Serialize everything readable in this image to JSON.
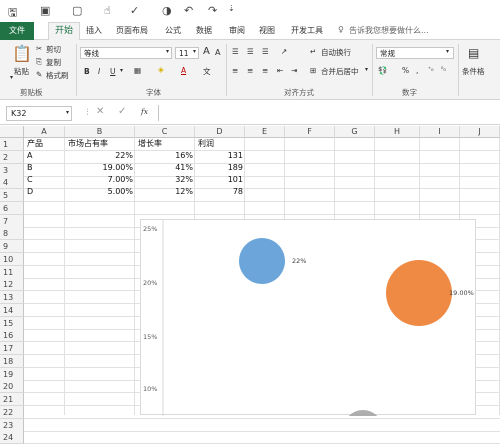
{
  "tabs": [
    "文件",
    "开始",
    "插入",
    "页面布局",
    "公式",
    "数据",
    "审阅",
    "视图",
    "开发工具"
  ],
  "tell_me": "告诉我您想要做什么...",
  "clipboard": {
    "paste": "粘贴",
    "cut": "剪切",
    "copy": "复制",
    "painter": "格式刷",
    "group": "剪贴板"
  },
  "font": {
    "name": "等线",
    "size": "11",
    "group": "字体",
    "bold": "B",
    "italic": "I",
    "underline": "U"
  },
  "align": {
    "wrap": "自动换行",
    "merge": "合并后居中",
    "group": "对齐方式"
  },
  "number": {
    "format": "常规",
    "group": "数字",
    "percent": "%"
  },
  "styles": {
    "cond": "条件格"
  },
  "namebox": "K32",
  "fx": "fx",
  "columns": [
    "A",
    "B",
    "C",
    "D",
    "E",
    "F",
    "G",
    "H",
    "I",
    "J"
  ],
  "rows": [
    "1",
    "2",
    "3",
    "4",
    "5",
    "6",
    "7",
    "8",
    "9",
    "10",
    "11",
    "12",
    "13",
    "14",
    "15",
    "16",
    "17",
    "18",
    "19",
    "20",
    "21",
    "22",
    "23",
    "24"
  ],
  "sheet": {
    "headers": [
      "产品",
      "市场占有率",
      "增长率",
      "利润"
    ],
    "data": [
      [
        "A",
        "22%",
        "16%",
        "131"
      ],
      [
        "B",
        "19.00%",
        "41%",
        "189"
      ],
      [
        "C",
        "7.00%",
        "32%",
        "101"
      ],
      [
        "D",
        "5.00%",
        "12%",
        "78"
      ]
    ]
  },
  "chart_data": {
    "type": "scatter",
    "y_ticks": [
      "25%",
      "20%",
      "15%",
      "10%"
    ],
    "bubbles": [
      {
        "label": "22%",
        "color": "#5b9bd5"
      },
      {
        "label": "19.00%",
        "color": "#ed7d31"
      },
      {
        "label": "",
        "color": "#a5a5a5"
      }
    ]
  }
}
